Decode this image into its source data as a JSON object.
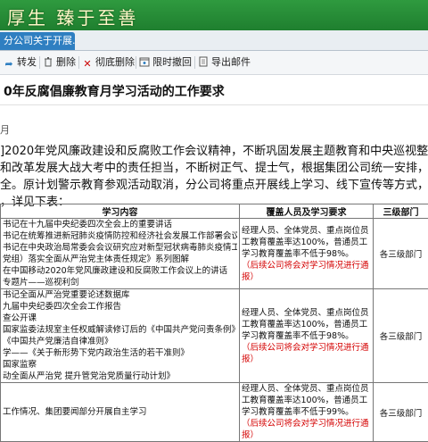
{
  "header": {
    "banner_text": "厚生  臻于至善",
    "tab_label": "分公司关于开展...",
    "tab_close": "×"
  },
  "toolbar": {
    "items": [
      {
        "label": "转发",
        "icon": "forward-icon"
      },
      {
        "label": "删除",
        "icon": "delete-icon"
      },
      {
        "label": "彻底删除",
        "icon": "permanent-delete-icon"
      },
      {
        "label": "限时撤回",
        "icon": "timed-recall-icon"
      },
      {
        "label": "导出邮件",
        "icon": "export-mail-icon"
      }
    ]
  },
  "email": {
    "title": "0年反腐倡廉教育月学习活动的工作要求",
    "meta": "月",
    "paragraph": [
      "]2020年党风廉政建设和反腐败工作会议精神，不断巩固发展主题教育和中央巡视整治整改成",
      "和改革发展大战大考中的责任担当，不断树正气、提士气，根据集团公司统一安排，计划在4",
      "全。原计划警示教育参观活动取消，分公司将重点开展线上学习、线下宣传等方式，灵活开展",
      "，详见下表："
    ]
  },
  "table": {
    "headers": {
      "content": "学习内容",
      "requirement": "覆盖人员及学习要求",
      "dept": "三级部门"
    },
    "rows": [
      {
        "content": [
          "书记在十九届中央纪委四次全会上的重要讲话",
          "书记在统筹推进新冠肺炎疫情防控和经济社会发展工作部署会议上的讲",
          "书记在中央政治局常委会会议研究应对新型冠状病毒肺炎疫情工作时的",
          "党组）落实全面从严治党主体责任规定》系列图解",
          "在中国移动2020年党风廉政建设和反腐败工作会议上的讲话",
          "专题片——巡视利剑"
        ],
        "req_main": "经理人员、全体党员、重点岗位员工教育覆盖率达100%，普通员工学习教育覆盖率不低于98%。",
        "req_note": "（后续公司将会对学习情况进行通报）",
        "dept": "各三级部门"
      },
      {
        "content": [
          "书记全面从严治党重要论述数据库",
          "九届中央纪委四次全会工作报告",
          "查公开课",
          "国家监委法规室主任权威解读修订后的《中国共产党问责条例》",
          "《中国共产党廉洁自律准则》",
          "学——《关于新形势下党内政治生活的若干准则》",
          "国家监察",
          "动全面从严治党 提升管党治党质量行动计划》"
        ],
        "req_main": "经理人员、全体党员、重点岗位员工教育覆盖率达100%，普通员工学习教育覆盖率不低于98%。",
        "req_note": "（后续公司将会对学习情况进行通报）",
        "dept": "各三级部门"
      },
      {
        "content": [
          "",
          "工作情况、集团要闻部分开展自主学习",
          ""
        ],
        "req_main": "经理人员、全体党员、重点岗位员工教育覆盖率达100%，普通员工学习教育覆盖率不低于99%。",
        "req_note": "（后续公司将会对学习情况进行通报）",
        "dept": "各三级部门"
      }
    ]
  },
  "colors": {
    "banner": "#1f7f2f",
    "tab": "#2f7fc1",
    "note": "#d40000"
  }
}
